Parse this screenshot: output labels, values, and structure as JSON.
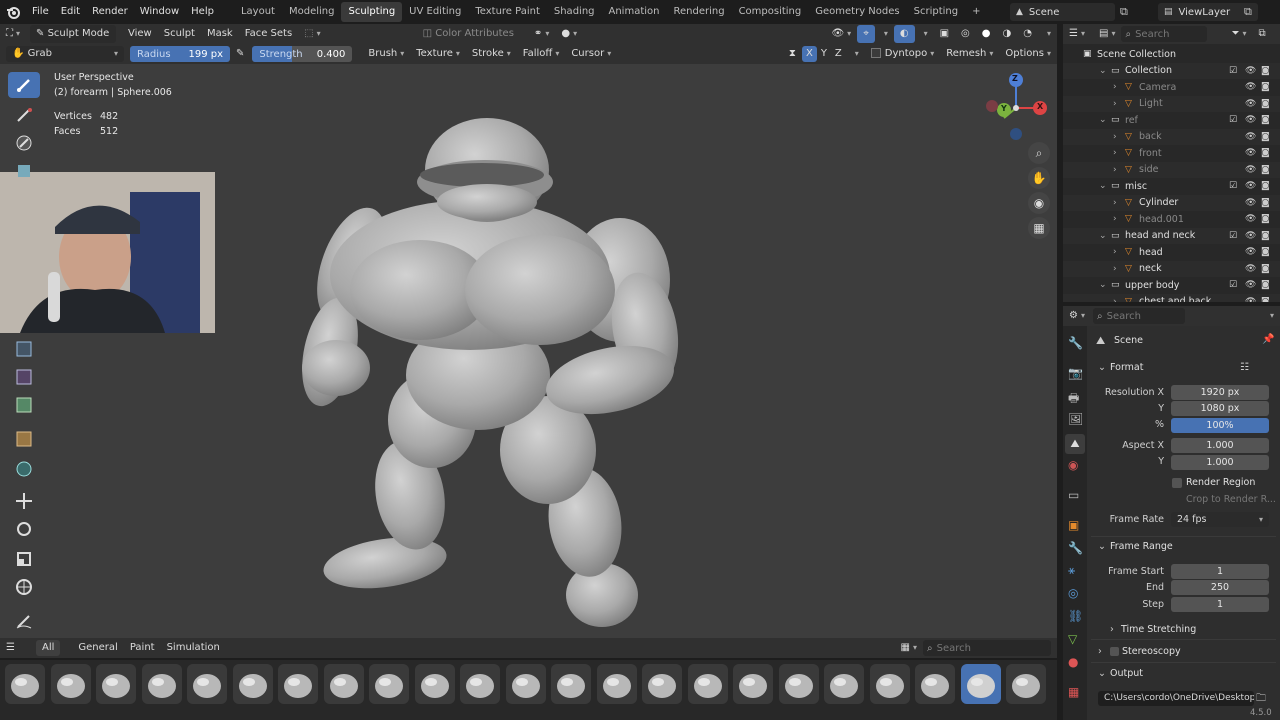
{
  "topbar": {
    "menus": [
      "File",
      "Edit",
      "Render",
      "Window",
      "Help"
    ],
    "workspaces": [
      "Layout",
      "Modeling",
      "Sculpting",
      "UV Editing",
      "Texture Paint",
      "Shading",
      "Animation",
      "Rendering",
      "Compositing",
      "Geometry Nodes",
      "Scripting"
    ],
    "active_workspace": "Sculpting",
    "add_tab": "+",
    "scene": "Scene",
    "view_layer": "ViewLayer"
  },
  "header": {
    "mode": "Sculpt Mode",
    "menus": [
      "View",
      "Sculpt",
      "Mask",
      "Face Sets"
    ],
    "color_attributes": "Color Attributes"
  },
  "tool_settings": {
    "tool": "Grab",
    "radius_label": "Radius",
    "radius_value": "199 px",
    "strength_label": "Strength",
    "strength_value": "0.400",
    "menus": [
      "Brush",
      "Texture",
      "Stroke",
      "Falloff",
      "Cursor"
    ],
    "axes": [
      "X",
      "Y",
      "Z"
    ],
    "dyntopo": "Dyntopo",
    "remesh": "Remesh",
    "options": "Options"
  },
  "overlay_info": {
    "view": "User Perspective",
    "object": "(2) forearm | Sphere.006",
    "vertices_label": "Vertices",
    "vertices_value": "482",
    "faces_label": "Faces",
    "faces_value": "512"
  },
  "gizmo_axes": [
    "Z",
    "X",
    "Y"
  ],
  "outliner": {
    "search_placeholder": "Search",
    "rows": [
      {
        "label": "Scene Collection",
        "indent": 0
      },
      {
        "label": "Collection",
        "indent": 1
      },
      {
        "label": "Camera",
        "indent": 2
      },
      {
        "label": "Light",
        "indent": 2
      },
      {
        "label": "ref",
        "indent": 1
      },
      {
        "label": "back",
        "indent": 2
      },
      {
        "label": "front",
        "indent": 2
      },
      {
        "label": "side",
        "indent": 2
      },
      {
        "label": "misc",
        "indent": 1
      },
      {
        "label": "Cylinder",
        "indent": 2
      },
      {
        "label": "head.001",
        "indent": 2
      },
      {
        "label": "head and neck",
        "indent": 1
      },
      {
        "label": "head",
        "indent": 2
      },
      {
        "label": "neck",
        "indent": 2
      },
      {
        "label": "upper body",
        "indent": 1
      },
      {
        "label": "chest and back",
        "indent": 2
      }
    ]
  },
  "properties": {
    "search_placeholder": "Search",
    "context": "Scene",
    "format_title": "Format",
    "resolution_x_label": "Resolution X",
    "resolution_x": "1920 px",
    "y_label": "Y",
    "resolution_y": "1080 px",
    "percent_label": "%",
    "percent": "100%",
    "aspect_x_label": "Aspect X",
    "aspect_x": "1.000",
    "aspect_y_label": "Y",
    "aspect_y": "1.000",
    "render_region": "Render Region",
    "crop": "Crop to Render R...",
    "frame_rate_label": "Frame Rate",
    "frame_rate": "24 fps",
    "frame_range_title": "Frame Range",
    "frame_start_label": "Frame Start",
    "frame_start": "1",
    "end_label": "End",
    "end": "250",
    "step_label": "Step",
    "step": "1",
    "time_stretching": "Time Stretching",
    "stereoscopy": "Stereoscopy",
    "output": "Output",
    "output_path": "C:\\Users\\cordo\\OneDrive\\Desktop\\"
  },
  "asset_shelf": {
    "tabs": [
      "All",
      "General",
      "Paint",
      "Simulation"
    ],
    "search_placeholder": "Search"
  },
  "version": "4.5.0"
}
